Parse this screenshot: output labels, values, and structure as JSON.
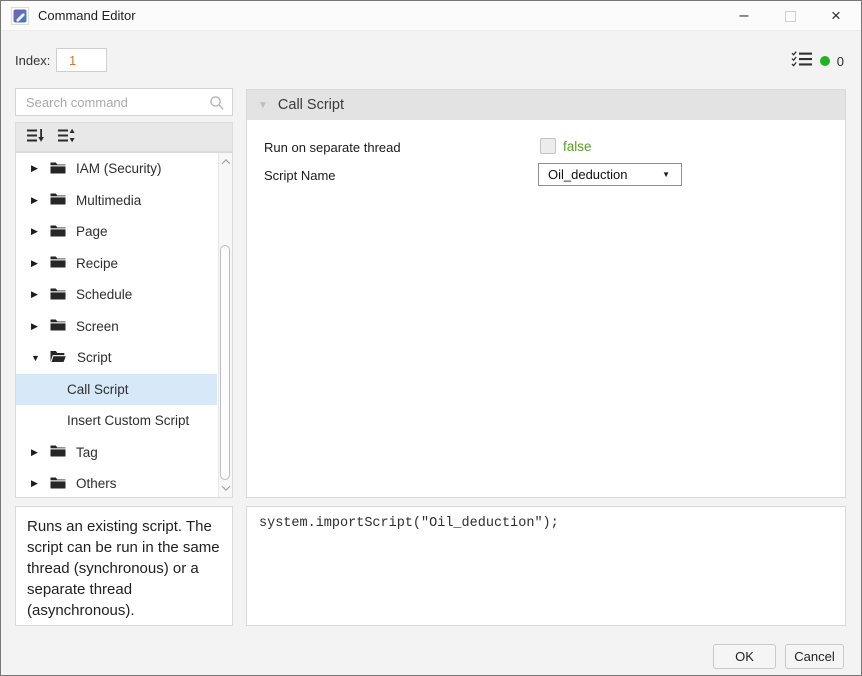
{
  "window": {
    "title": "Command Editor",
    "minimize_glyph": "–",
    "close_glyph": "×"
  },
  "header_bar": {
    "index_label": "Index:",
    "index_value": "1",
    "validation_count": "0"
  },
  "search": {
    "placeholder": "Search command"
  },
  "tree": {
    "items": [
      {
        "label": "IAM (Security)",
        "type": "folder",
        "expanded": false,
        "selected": false
      },
      {
        "label": "Multimedia",
        "type": "folder",
        "expanded": false,
        "selected": false
      },
      {
        "label": "Page",
        "type": "folder",
        "expanded": false,
        "selected": false
      },
      {
        "label": "Recipe",
        "type": "folder",
        "expanded": false,
        "selected": false
      },
      {
        "label": "Schedule",
        "type": "folder",
        "expanded": false,
        "selected": false
      },
      {
        "label": "Screen",
        "type": "folder",
        "expanded": false,
        "selected": false
      },
      {
        "label": "Script",
        "type": "folder",
        "expanded": true,
        "selected": false
      },
      {
        "label": "Call Script",
        "type": "command",
        "expanded": false,
        "selected": true
      },
      {
        "label": "Insert Custom Script",
        "type": "command",
        "expanded": false,
        "selected": false
      },
      {
        "label": "Tag",
        "type": "folder",
        "expanded": false,
        "selected": false
      },
      {
        "label": "Others",
        "type": "folder",
        "expanded": false,
        "selected": false
      }
    ]
  },
  "description": {
    "text": "Runs an existing script. The script can be run in the same thread (synchronous) or a separate thread (asynchronous)."
  },
  "editor": {
    "title": "Call Script",
    "rows": [
      {
        "label": "Run on separate thread",
        "control": "checkbox",
        "value": "false",
        "checked": false
      },
      {
        "label": "Script Name",
        "control": "dropdown",
        "value": "Oil_deduction"
      }
    ]
  },
  "code_preview": {
    "text": "system.importScript(\"Oil_deduction\");"
  },
  "footer": {
    "ok_label": "OK",
    "cancel_label": "Cancel"
  },
  "colors": {
    "boolean_false_green": "#5c9e25",
    "status_dot_green": "#22b322",
    "index_value_orange": "#ce7b3a",
    "selection_blue": "#d7e9f9"
  }
}
